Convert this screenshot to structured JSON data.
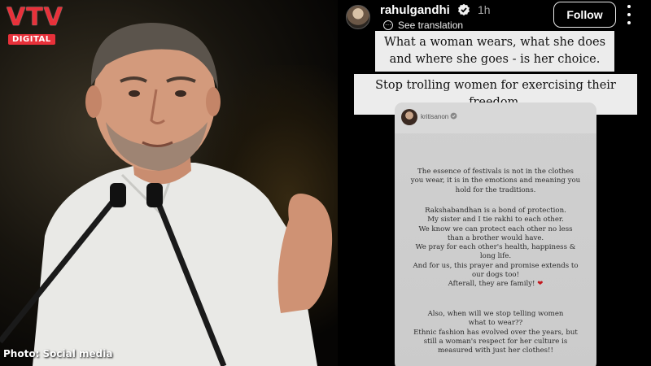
{
  "branding": {
    "logo_main": "VTV",
    "logo_sub": "DIGITAL",
    "logo_color": "#e8313a"
  },
  "photo": {
    "credit": "Photo: Social media"
  },
  "post": {
    "username": "rahulgandhi",
    "time": "1h",
    "see_translation": "See translation",
    "follow_label": "Follow",
    "quote_1": "What a woman wears, what she does and where she goes - is her choice.",
    "quote_2": "Stop trolling women for exercising their freedom."
  },
  "story": {
    "username": "kritisanon",
    "paragraph_1": "The essence of festivals is not in the clothes\nyou wear, it is in the emotions and meaning you\nhold for the traditions.",
    "paragraph_2": "Rakshabandhan is a bond of protection.\nMy sister and I tie rakhi to each other.\nWe know we can protect each other no less\nthan a brother would have.\nWe pray for each other's health, happiness &\nlong life.\nAnd for us, this prayer and promise extends to\nour dogs too!\nAfterall, they are family!",
    "heart": "❤",
    "paragraph_3": "Also, when will we stop telling women\nwhat to wear??\nEthnic fashion has evolved over the years, but\nstill a woman's respect for her culture is\nmeasured with just her clothes!!"
  }
}
